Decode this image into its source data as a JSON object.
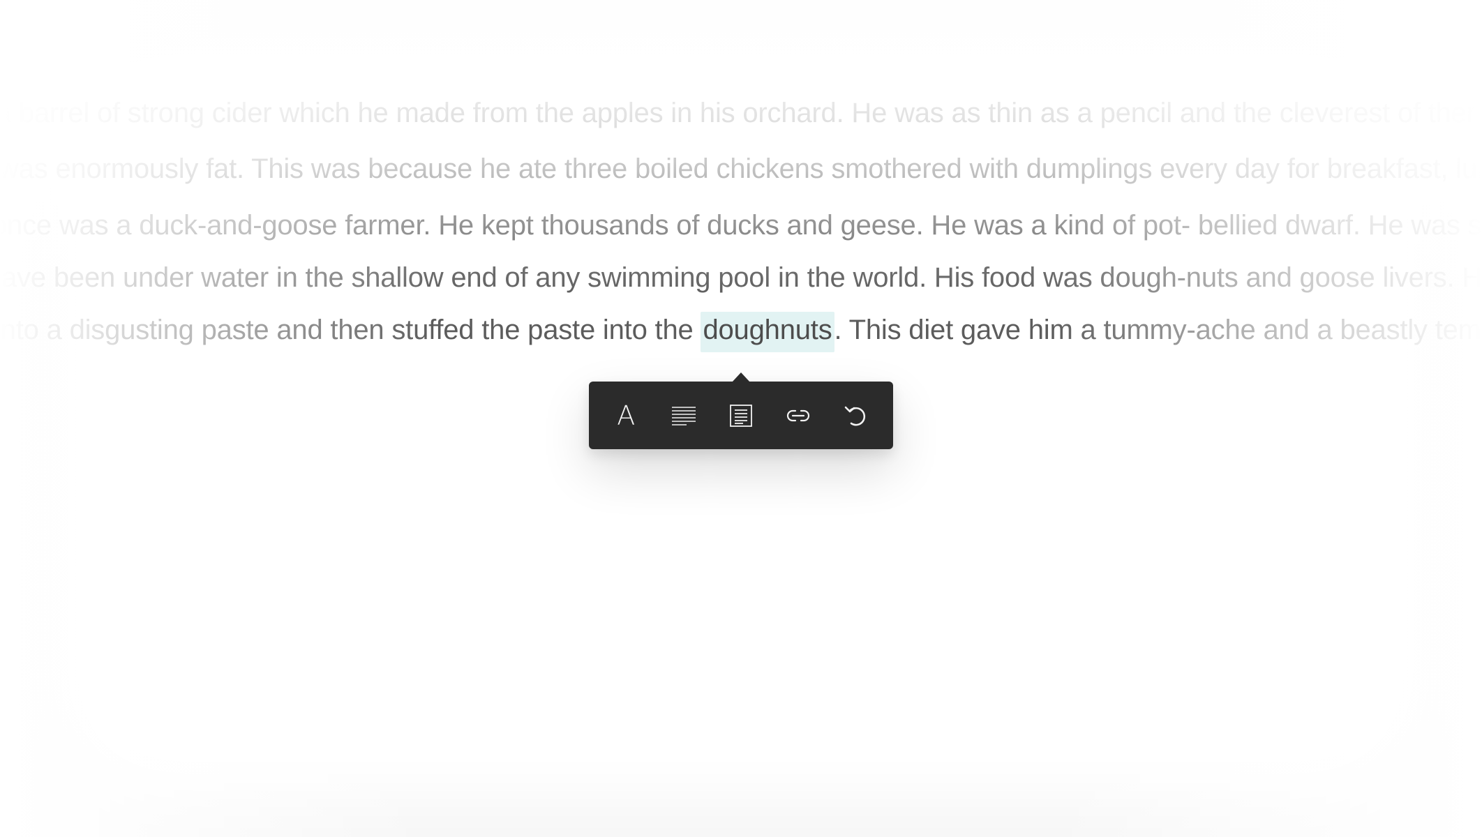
{
  "document": {
    "lines": [
      "a barrel of strong cider which he made from the apples in his orchard. He was as thin as a pencil and the cleverest of them all.",
      "was enormously fat. This was because he ate three boiled chickens smothered with dumplings every day for breakfast, lunch",
      "once was a duck-and-goose farmer. He kept thousands of ducks and geese. He was a kind of pot- bellied dwarf. He was so short",
      "have been under water in the shallow end of any swimming pool in the world. His food was dough-nuts and goose livers. He mashed",
      "into a disgusting paste and then stuffed the paste into the "
    ],
    "highlighted_word": "doughnuts",
    "line5_after": ". This diet gave him a tummy-ache and a beastly temper."
  },
  "toolbar": {
    "buttons": [
      {
        "icon": "font-icon",
        "glyph": "A"
      },
      {
        "icon": "text-width-icon"
      },
      {
        "icon": "text-column-icon"
      },
      {
        "icon": "link-icon"
      },
      {
        "icon": "undo-icon"
      }
    ]
  },
  "colors": {
    "text": "#5c5c5c",
    "highlight": "#e2f3f3",
    "toolbar_bg": "#2b2b2b",
    "icon": "#f2f2f2",
    "background": "#f7f7f7"
  }
}
